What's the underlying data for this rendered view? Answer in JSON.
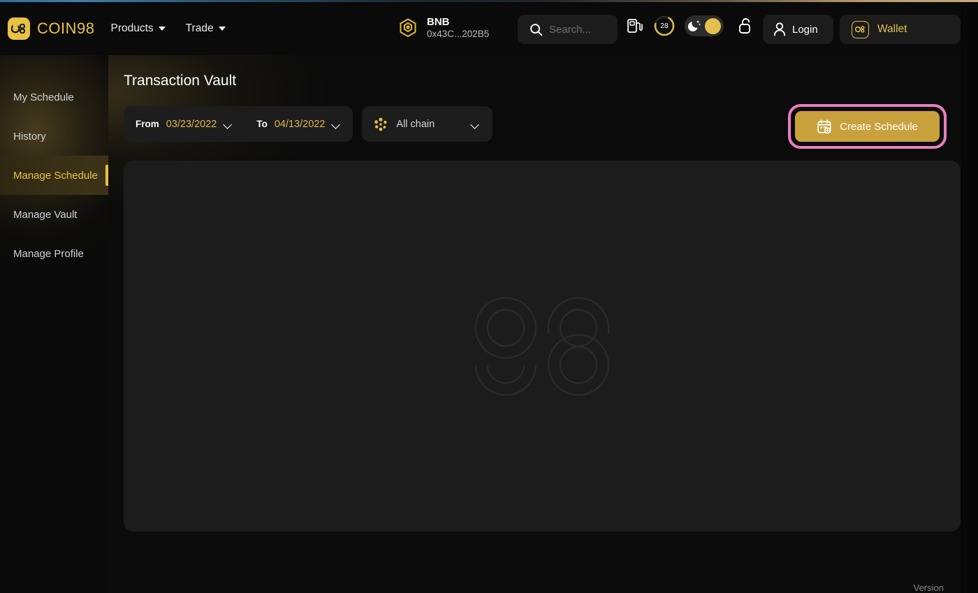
{
  "header": {
    "brand_name": "COIN98",
    "brand_icon": "coin98-logo-icon",
    "nav": [
      {
        "label": "Products",
        "icon": "chevron-down-icon"
      },
      {
        "label": "Trade",
        "icon": "chevron-down-icon"
      }
    ],
    "chain": {
      "icon": "bnb-token-icon",
      "name": "BNB",
      "address": "0x43C...202B5"
    },
    "search": {
      "icon": "search-icon",
      "placeholder": "Search..."
    },
    "gas_icon": "gas-pump-icon",
    "gauge": {
      "icon": "gas-gauge-icon",
      "value": "28",
      "percent": 70,
      "color": "#d9b94a"
    },
    "theme_toggle": {
      "icon": "moon-stars-icon",
      "state": "dark",
      "knob_color": "#e3c14f"
    },
    "lock_icon": "unlocked-padlock-icon",
    "login": {
      "icon": "user-icon",
      "label": "Login"
    },
    "wallet": {
      "icon": "coin98-wallet-icon",
      "label": "Wallet",
      "color": "#e3c14f"
    }
  },
  "sidebar": {
    "items": [
      {
        "label": "My Schedule",
        "active": false
      },
      {
        "label": "History",
        "active": false
      },
      {
        "label": "Manage Schedule",
        "active": true
      },
      {
        "label": "Manage Vault",
        "active": false
      },
      {
        "label": "Manage Profile",
        "active": false
      }
    ],
    "active_color": "#e8c245"
  },
  "main": {
    "title": "Transaction Vault",
    "filters": {
      "from_label": "From",
      "from_value": "03/23/2022",
      "to_label": "To",
      "to_value": "04/13/2022",
      "chain_label": "All chain",
      "chain_icon": "all-chain-dots-icon",
      "date_color": "#e3b948"
    },
    "create_button": {
      "label": "Create Schedule",
      "icon": "calendar-plus-icon",
      "bg_color": "#c9a13c",
      "highlight_color": "#ea7ec0"
    },
    "empty_state": {
      "icon": "coin98-watermark-icon"
    }
  },
  "footer": {
    "version_label": "Version"
  }
}
